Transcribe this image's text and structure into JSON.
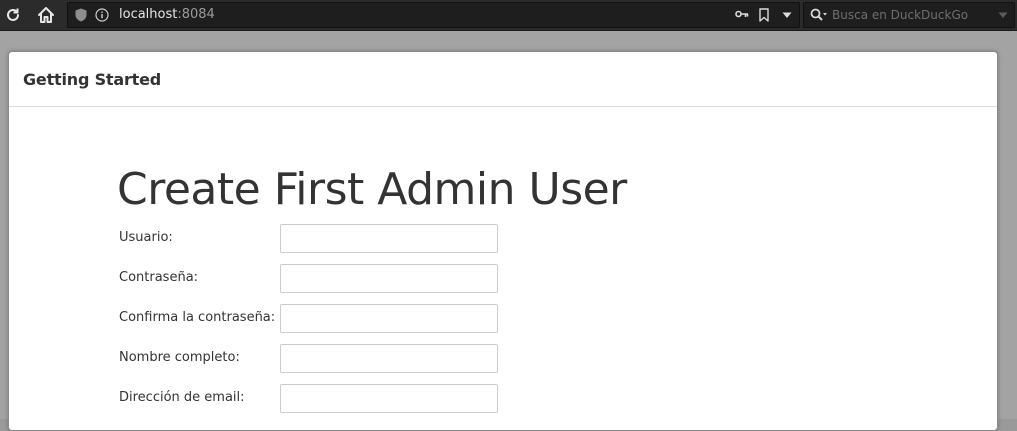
{
  "browser": {
    "url_host": "localhost",
    "url_port": ":8084",
    "search_placeholder": "Busca en DuckDuckGo"
  },
  "panel": {
    "title": "Getting Started"
  },
  "form": {
    "heading": "Create First Admin User",
    "fields": [
      {
        "label": "Usuario:",
        "value": ""
      },
      {
        "label": "Contraseña:",
        "value": ""
      },
      {
        "label": "Confirma la contraseña:",
        "value": ""
      },
      {
        "label": "Nombre completo:",
        "value": ""
      },
      {
        "label": "Dirección de email:",
        "value": ""
      }
    ]
  },
  "icons": {
    "reload": "reload-icon",
    "home": "home-icon",
    "shield": "shield-icon",
    "info": "info-icon",
    "key": "key-icon",
    "bookmark": "bookmark-icon",
    "dropdown": "chevron-down-icon",
    "search": "search-icon"
  },
  "colors": {
    "toolbar": "#2b2b2b",
    "urlbar": "#1e1e1e",
    "page_bg": "#a3a3a3",
    "panel_bg": "#ffffff",
    "text": "#333333"
  }
}
